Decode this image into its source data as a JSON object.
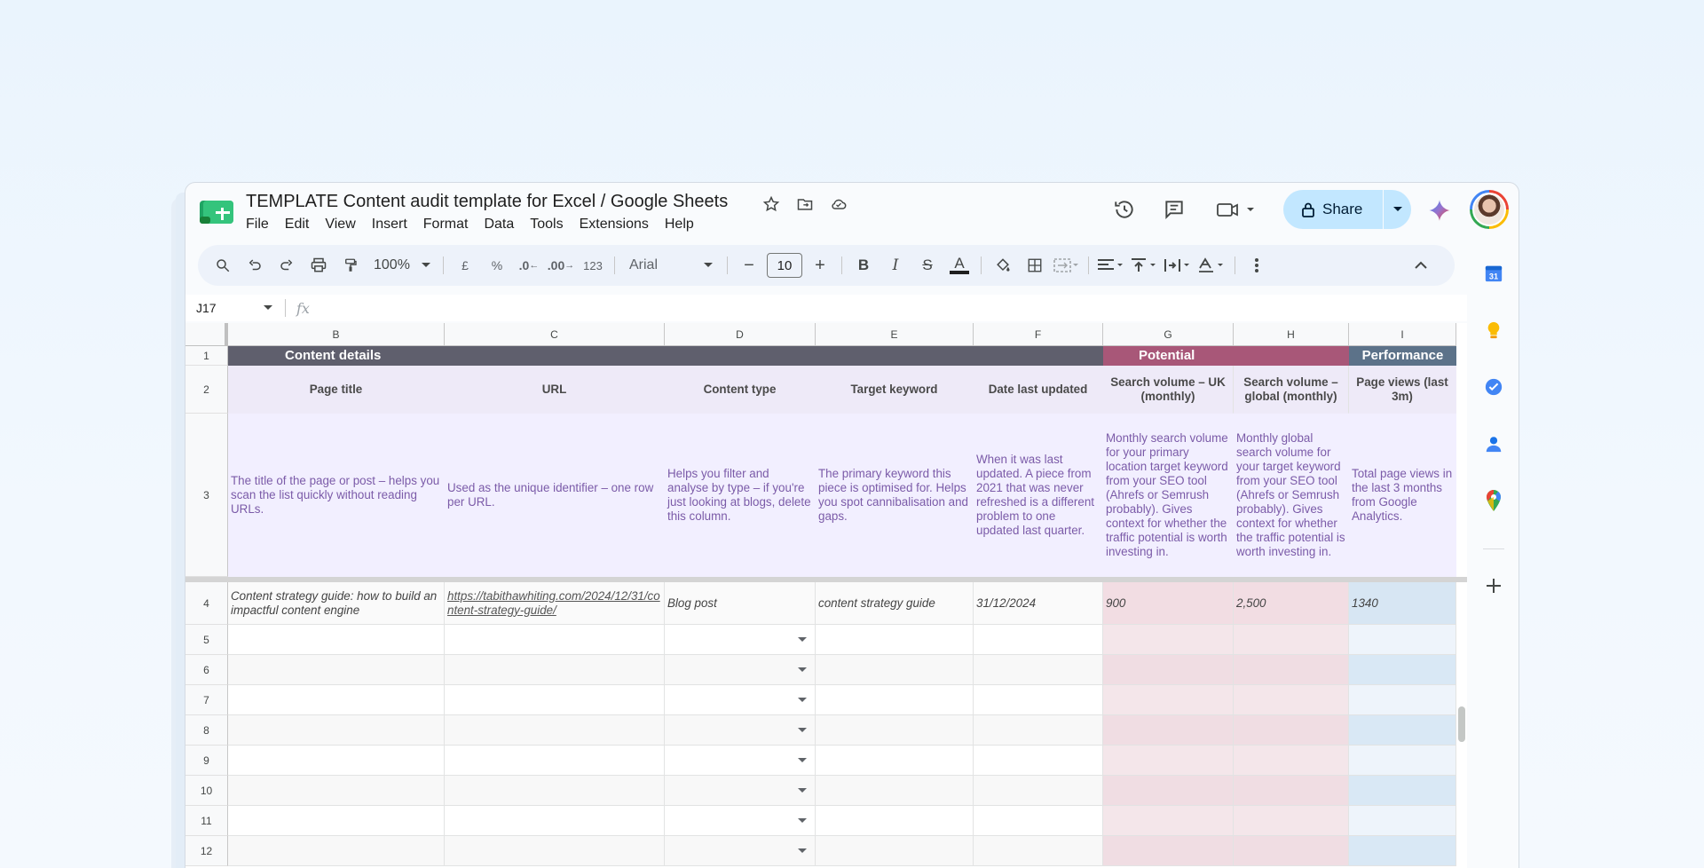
{
  "doc": {
    "title": "TEMPLATE Content audit template for Excel / Google Sheets"
  },
  "menu": [
    "File",
    "Edit",
    "View",
    "Insert",
    "Format",
    "Data",
    "Tools",
    "Extensions",
    "Help"
  ],
  "share": {
    "label": "Share"
  },
  "toolbar": {
    "zoom": "100%",
    "currency": "£",
    "percent": "%",
    "dec_decrease": ".0",
    "dec_increase": ".00",
    "format_more": "123",
    "font": "Arial",
    "font_size": "10"
  },
  "formula_bar": {
    "name_box": "J17",
    "fx": "fx"
  },
  "columns": [
    "B",
    "C",
    "D",
    "E",
    "F",
    "G",
    "H",
    "I"
  ],
  "sections": {
    "content_details": "Content details",
    "potential": "Potential",
    "performance": "Performance"
  },
  "headers": {
    "B": "Page title",
    "C": "URL",
    "D": "Content type",
    "E": "Target keyword",
    "F": "Date last updated",
    "G": "Search volume – UK (monthly)",
    "H": "Search volume – global (monthly)",
    "I": "Page views (last 3m)"
  },
  "descriptions": {
    "B": "The title of the page or post – helps you scan the list quickly without reading URLs.",
    "C": "Used as the unique identifier – one row per URL.",
    "D": "Helps you filter and analyse by type – if you're just looking at blogs, delete this column.",
    "E": "The primary keyword this piece is optimised for. Helps you spot cannibalisation and gaps.",
    "F": "When it was last updated. A piece from 2021 that was never refreshed is a different problem to one updated last quarter.",
    "G": "Monthly search volume for your primary location target keyword from your SEO tool (Ahrefs or Semrush probably). Gives context for whether the traffic potential is worth investing in.",
    "H": "Monthly global search volume for your target keyword from your SEO tool (Ahrefs or Semrush probably). Gives context for whether the traffic potential is worth investing in.",
    "I": "Total page views in the last 3 months from Google Analytics."
  },
  "row4": {
    "B": "Content strategy guide: how to build an impactful content engine",
    "C": "https://tabithawhiting.com/2024/12/31/content-strategy-guide/",
    "D": "Blog post",
    "E": "content strategy guide",
    "F": "31/12/2024",
    "G": "900",
    "H": "2,500",
    "I": "1340"
  },
  "row_numbers": [
    "1",
    "2",
    "3",
    "4",
    "5",
    "6",
    "7",
    "8",
    "9",
    "10",
    "11",
    "12"
  ],
  "side_panel": [
    "calendar-icon",
    "keep-icon",
    "tasks-icon",
    "contacts-icon",
    "maps-icon",
    "add-icon"
  ],
  "colors": {
    "section_details": "#5f5f6d",
    "section_potential": "#a85778",
    "section_performance": "#5c7289",
    "share_bg": "#c2e7ff"
  }
}
